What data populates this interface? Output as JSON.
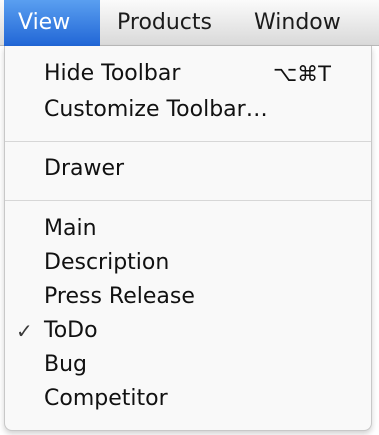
{
  "menubar": {
    "items": [
      {
        "label": "View",
        "active": true
      },
      {
        "label": "Products",
        "active": false
      },
      {
        "label": "Window",
        "active": false
      }
    ]
  },
  "menu": {
    "groups": [
      [
        {
          "label": "Hide Toolbar",
          "shortcut": "⌥⌘T"
        },
        {
          "label": "Customize Toolbar…",
          "shortcut": ""
        }
      ],
      [
        {
          "label": "Drawer",
          "shortcut": ""
        }
      ],
      [
        {
          "label": "Main",
          "checked": false
        },
        {
          "label": "Description",
          "checked": false
        },
        {
          "label": "Press Release",
          "checked": false
        },
        {
          "label": "ToDo",
          "checked": true
        },
        {
          "label": "Bug",
          "checked": false
        },
        {
          "label": "Competitor",
          "checked": false
        }
      ]
    ],
    "check_glyph": "✓"
  },
  "colors": {
    "active_menu_top": "#5a9ff0",
    "active_menu_bottom": "#2166d6",
    "menu_background": "#f9f9f9",
    "separator": "#d7d7d7"
  }
}
